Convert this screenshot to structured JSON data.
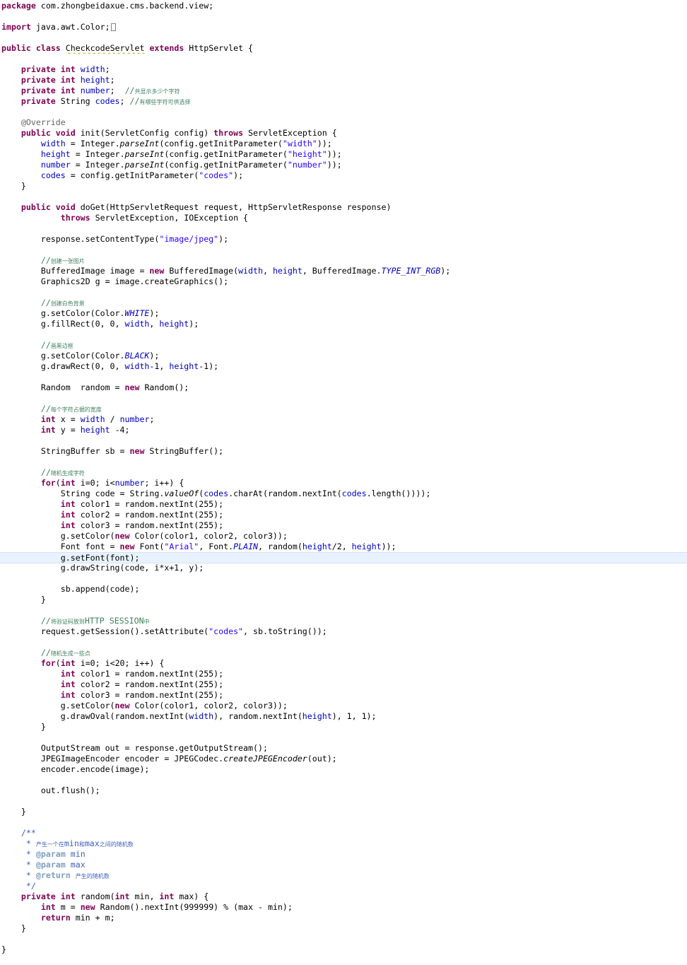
{
  "editor": {
    "language": "Java",
    "current_line": 52,
    "colors": {
      "keyword": "#7f0055",
      "field": "#0000c0",
      "string": "#2a00ff",
      "comment": "#3f7f5f",
      "javadoc": "#3f5fbf",
      "javadoc_tag": "#7f9fbf",
      "annotation": "#646464",
      "current_line_highlight": "#e8f2fe"
    },
    "lines": [
      [
        {
          "t": "package",
          "c": "kw"
        },
        {
          "t": " com.zhongbeidaxue.cms.backend.view;"
        }
      ],
      [],
      [
        {
          "t": "import",
          "c": "kw"
        },
        {
          "t": " java.awt.Color;"
        },
        {
          "t": "",
          "c": "fold"
        }
      ],
      [],
      [
        {
          "t": "public",
          "c": "kw"
        },
        {
          "t": " "
        },
        {
          "t": "class",
          "c": "kw"
        },
        {
          "t": " "
        },
        {
          "t": "CheckcodeServlet",
          "c": "warn"
        },
        {
          "t": " "
        },
        {
          "t": "extends",
          "c": "kw"
        },
        {
          "t": " HttpServlet {"
        }
      ],
      [],
      [
        {
          "t": "    "
        },
        {
          "t": "private",
          "c": "kw"
        },
        {
          "t": " "
        },
        {
          "t": "int",
          "c": "kw"
        },
        {
          "t": " "
        },
        {
          "t": "width",
          "c": "field"
        },
        {
          "t": ";"
        }
      ],
      [
        {
          "t": "    "
        },
        {
          "t": "private",
          "c": "kw"
        },
        {
          "t": " "
        },
        {
          "t": "int",
          "c": "kw"
        },
        {
          "t": " "
        },
        {
          "t": "height",
          "c": "field"
        },
        {
          "t": ";"
        }
      ],
      [
        {
          "t": "    "
        },
        {
          "t": "private",
          "c": "kw"
        },
        {
          "t": " "
        },
        {
          "t": "int",
          "c": "kw"
        },
        {
          "t": " "
        },
        {
          "t": "number",
          "c": "field"
        },
        {
          "t": ";  "
        },
        {
          "t": "//",
          "c": "com"
        },
        {
          "t": "共显示多少个字符",
          "c": "cjk"
        }
      ],
      [
        {
          "t": "    "
        },
        {
          "t": "private",
          "c": "kw"
        },
        {
          "t": " String "
        },
        {
          "t": "codes",
          "c": "field"
        },
        {
          "t": "; "
        },
        {
          "t": "//",
          "c": "com"
        },
        {
          "t": "有哪些字符可供选择",
          "c": "cjk"
        }
      ],
      [],
      [
        {
          "t": "    "
        },
        {
          "t": "@Override",
          "c": "ann"
        }
      ],
      [
        {
          "t": "    "
        },
        {
          "t": "public",
          "c": "kw"
        },
        {
          "t": " "
        },
        {
          "t": "void",
          "c": "kw"
        },
        {
          "t": " init(ServletConfig config) "
        },
        {
          "t": "throws",
          "c": "kw"
        },
        {
          "t": " ServletException {"
        }
      ],
      [
        {
          "t": "        "
        },
        {
          "t": "width",
          "c": "field"
        },
        {
          "t": " = Integer."
        },
        {
          "t": "parseInt",
          "c": "static-i"
        },
        {
          "t": "(config.getInitParameter("
        },
        {
          "t": "\"width\"",
          "c": "str"
        },
        {
          "t": "));"
        }
      ],
      [
        {
          "t": "        "
        },
        {
          "t": "height",
          "c": "field"
        },
        {
          "t": " = Integer."
        },
        {
          "t": "parseInt",
          "c": "static-i"
        },
        {
          "t": "(config.getInitParameter("
        },
        {
          "t": "\"height\"",
          "c": "str"
        },
        {
          "t": "));"
        }
      ],
      [
        {
          "t": "        "
        },
        {
          "t": "number",
          "c": "field"
        },
        {
          "t": " = Integer."
        },
        {
          "t": "parseInt",
          "c": "static-i"
        },
        {
          "t": "(config.getInitParameter("
        },
        {
          "t": "\"number\"",
          "c": "str"
        },
        {
          "t": "));"
        }
      ],
      [
        {
          "t": "        "
        },
        {
          "t": "codes",
          "c": "field"
        },
        {
          "t": " = config.getInitParameter("
        },
        {
          "t": "\"codes\"",
          "c": "str"
        },
        {
          "t": ");"
        }
      ],
      [
        {
          "t": "    }"
        }
      ],
      [],
      [
        {
          "t": "    "
        },
        {
          "t": "public",
          "c": "kw"
        },
        {
          "t": " "
        },
        {
          "t": "void",
          "c": "kw"
        },
        {
          "t": " doGet(HttpServletRequest request, HttpServletResponse response)"
        }
      ],
      [
        {
          "t": "            "
        },
        {
          "t": "throws",
          "c": "kw"
        },
        {
          "t": " ServletException, IOException {"
        }
      ],
      [],
      [
        {
          "t": "        response.setContentType("
        },
        {
          "t": "\"image/jpeg\"",
          "c": "str"
        },
        {
          "t": ");"
        }
      ],
      [],
      [
        {
          "t": "        "
        },
        {
          "t": "//",
          "c": "com"
        },
        {
          "t": "创建一张图片",
          "c": "cjk"
        }
      ],
      [
        {
          "t": "        BufferedImage image = "
        },
        {
          "t": "new",
          "c": "kw"
        },
        {
          "t": " BufferedImage("
        },
        {
          "t": "width",
          "c": "field"
        },
        {
          "t": ", "
        },
        {
          "t": "height",
          "c": "field"
        },
        {
          "t": ", BufferedImage."
        },
        {
          "t": "TYPE_INT_RGB",
          "c": "const-i"
        },
        {
          "t": ");"
        }
      ],
      [
        {
          "t": "        Graphics2D g = image.createGraphics();"
        }
      ],
      [],
      [
        {
          "t": "        "
        },
        {
          "t": "//",
          "c": "com"
        },
        {
          "t": "创建白色背景",
          "c": "cjk"
        }
      ],
      [
        {
          "t": "        g.setColor(Color."
        },
        {
          "t": "WHITE",
          "c": "const-i"
        },
        {
          "t": ");"
        }
      ],
      [
        {
          "t": "        g.fillRect(0, 0, "
        },
        {
          "t": "width",
          "c": "field"
        },
        {
          "t": ", "
        },
        {
          "t": "height",
          "c": "field"
        },
        {
          "t": ");"
        }
      ],
      [],
      [
        {
          "t": "        "
        },
        {
          "t": "//",
          "c": "com"
        },
        {
          "t": "画黑边框",
          "c": "cjk"
        }
      ],
      [
        {
          "t": "        g.setColor(Color."
        },
        {
          "t": "BLACK",
          "c": "const-i"
        },
        {
          "t": ");"
        }
      ],
      [
        {
          "t": "        g.drawRect(0, 0, "
        },
        {
          "t": "width",
          "c": "field"
        },
        {
          "t": "-1, "
        },
        {
          "t": "height",
          "c": "field"
        },
        {
          "t": "-1);"
        }
      ],
      [],
      [
        {
          "t": "        Random  random = "
        },
        {
          "t": "new",
          "c": "kw"
        },
        {
          "t": " Random();"
        }
      ],
      [],
      [
        {
          "t": "        "
        },
        {
          "t": "//",
          "c": "com"
        },
        {
          "t": "每个字符占据的宽度",
          "c": "cjk"
        }
      ],
      [
        {
          "t": "        "
        },
        {
          "t": "int",
          "c": "kw"
        },
        {
          "t": " x = "
        },
        {
          "t": "width",
          "c": "field"
        },
        {
          "t": " / "
        },
        {
          "t": "number",
          "c": "field"
        },
        {
          "t": ";"
        }
      ],
      [
        {
          "t": "        "
        },
        {
          "t": "int",
          "c": "kw"
        },
        {
          "t": " y = "
        },
        {
          "t": "height",
          "c": "field"
        },
        {
          "t": " -4;"
        }
      ],
      [],
      [
        {
          "t": "        StringBuffer sb = "
        },
        {
          "t": "new",
          "c": "kw"
        },
        {
          "t": " StringBuffer();"
        }
      ],
      [],
      [
        {
          "t": "        "
        },
        {
          "t": "//",
          "c": "com"
        },
        {
          "t": "随机生成字符",
          "c": "cjk"
        }
      ],
      [
        {
          "t": "        "
        },
        {
          "t": "for",
          "c": "kw"
        },
        {
          "t": "("
        },
        {
          "t": "int",
          "c": "kw"
        },
        {
          "t": " i=0; i<"
        },
        {
          "t": "number",
          "c": "field"
        },
        {
          "t": "; i++) {"
        }
      ],
      [
        {
          "t": "            String code = String."
        },
        {
          "t": "valueOf",
          "c": "static-i"
        },
        {
          "t": "("
        },
        {
          "t": "codes",
          "c": "field"
        },
        {
          "t": ".charAt(random.nextInt("
        },
        {
          "t": "codes",
          "c": "field"
        },
        {
          "t": ".length())));"
        }
      ],
      [
        {
          "t": "            "
        },
        {
          "t": "int",
          "c": "kw"
        },
        {
          "t": " color1 = random.nextInt(255);"
        }
      ],
      [
        {
          "t": "            "
        },
        {
          "t": "int",
          "c": "kw"
        },
        {
          "t": " color2 = random.nextInt(255);"
        }
      ],
      [
        {
          "t": "            "
        },
        {
          "t": "int",
          "c": "kw"
        },
        {
          "t": " color3 = random.nextInt(255);"
        }
      ],
      [
        {
          "t": "            g.setColor("
        },
        {
          "t": "new",
          "c": "kw"
        },
        {
          "t": " Color(color1, color2, color3));"
        }
      ],
      [
        {
          "t": "            Font font = "
        },
        {
          "t": "new",
          "c": "kw"
        },
        {
          "t": " Font("
        },
        {
          "t": "\"Arial\"",
          "c": "str"
        },
        {
          "t": ", Font."
        },
        {
          "t": "PLAIN",
          "c": "const-i"
        },
        {
          "t": ", random("
        },
        {
          "t": "height",
          "c": "field"
        },
        {
          "t": "/2, "
        },
        {
          "t": "height",
          "c": "field"
        },
        {
          "t": "));"
        }
      ],
      [
        {
          "t": "            g.setFont(font);"
        }
      ],
      [
        {
          "t": "            g.drawString(code, i*x+1, y);"
        }
      ],
      [],
      [
        {
          "t": "            sb.append(code);"
        }
      ],
      [
        {
          "t": "        }"
        }
      ],
      [],
      [
        {
          "t": "        "
        },
        {
          "t": "//",
          "c": "com"
        },
        {
          "t": "将验证码放到",
          "c": "cjk"
        },
        {
          "t": "HTTP SESSION",
          "c": "com"
        },
        {
          "t": "中",
          "c": "cjk"
        }
      ],
      [
        {
          "t": "        request.getSession().setAttribute("
        },
        {
          "t": "\"codes\"",
          "c": "str"
        },
        {
          "t": ", sb.toString());"
        }
      ],
      [],
      [
        {
          "t": "        "
        },
        {
          "t": "//",
          "c": "com"
        },
        {
          "t": "随机生成一些点",
          "c": "cjk"
        }
      ],
      [
        {
          "t": "        "
        },
        {
          "t": "for",
          "c": "kw"
        },
        {
          "t": "("
        },
        {
          "t": "int",
          "c": "kw"
        },
        {
          "t": " i=0; i<20; i++) {"
        }
      ],
      [
        {
          "t": "            "
        },
        {
          "t": "int",
          "c": "kw"
        },
        {
          "t": " color1 = random.nextInt(255);"
        }
      ],
      [
        {
          "t": "            "
        },
        {
          "t": "int",
          "c": "kw"
        },
        {
          "t": " color2 = random.nextInt(255);"
        }
      ],
      [
        {
          "t": "            "
        },
        {
          "t": "int",
          "c": "kw"
        },
        {
          "t": " color3 = random.nextInt(255);"
        }
      ],
      [
        {
          "t": "            g.setColor("
        },
        {
          "t": "new",
          "c": "kw"
        },
        {
          "t": " Color(color1, color2, color3));"
        }
      ],
      [
        {
          "t": "            g.drawOval(random.nextInt("
        },
        {
          "t": "width",
          "c": "field"
        },
        {
          "t": "), random.nextInt("
        },
        {
          "t": "height",
          "c": "field"
        },
        {
          "t": "), 1, 1);"
        }
      ],
      [
        {
          "t": "        }"
        }
      ],
      [],
      [
        {
          "t": "        OutputStream out = response.getOutputStream();"
        }
      ],
      [
        {
          "t": "        JPEGImageEncoder encoder = JPEGCodec."
        },
        {
          "t": "createJPEGEncoder",
          "c": "static-i"
        },
        {
          "t": "(out);"
        }
      ],
      [
        {
          "t": "        encoder.encode(image);"
        }
      ],
      [],
      [
        {
          "t": "        out.flush();"
        }
      ],
      [],
      [
        {
          "t": "    }"
        }
      ],
      [],
      [
        {
          "t": "    "
        },
        {
          "t": "/**",
          "c": "doc"
        }
      ],
      [
        {
          "t": "     * ",
          "c": "doc"
        },
        {
          "t": "产生一个在",
          "c": "docsm"
        },
        {
          "t": "min",
          "c": "doc"
        },
        {
          "t": "和",
          "c": "docsm"
        },
        {
          "t": "max",
          "c": "doc"
        },
        {
          "t": "之间的随机数",
          "c": "docsm"
        }
      ],
      [
        {
          "t": "     * ",
          "c": "doc"
        },
        {
          "t": "@param",
          "c": "doctag"
        },
        {
          "t": " min",
          "c": "doc"
        }
      ],
      [
        {
          "t": "     * ",
          "c": "doc"
        },
        {
          "t": "@param",
          "c": "doctag"
        },
        {
          "t": " max",
          "c": "doc"
        }
      ],
      [
        {
          "t": "     * ",
          "c": "doc"
        },
        {
          "t": "@return",
          "c": "doctag"
        },
        {
          "t": " ",
          "c": "doc"
        },
        {
          "t": "产生的随机数",
          "c": "docsm"
        }
      ],
      [
        {
          "t": "     */",
          "c": "doc"
        }
      ],
      [
        {
          "t": "    "
        },
        {
          "t": "private",
          "c": "kw"
        },
        {
          "t": " "
        },
        {
          "t": "int",
          "c": "kw"
        },
        {
          "t": " random("
        },
        {
          "t": "int",
          "c": "kw"
        },
        {
          "t": " min, "
        },
        {
          "t": "int",
          "c": "kw"
        },
        {
          "t": " max) {"
        }
      ],
      [
        {
          "t": "        "
        },
        {
          "t": "int",
          "c": "kw"
        },
        {
          "t": " m = "
        },
        {
          "t": "new",
          "c": "kw"
        },
        {
          "t": " Random().nextInt(999999) % (max - min);"
        }
      ],
      [
        {
          "t": "        "
        },
        {
          "t": "return",
          "c": "kw"
        },
        {
          "t": " min + m;"
        }
      ],
      [
        {
          "t": "    }"
        }
      ],
      [],
      [
        {
          "t": "}"
        }
      ]
    ]
  }
}
